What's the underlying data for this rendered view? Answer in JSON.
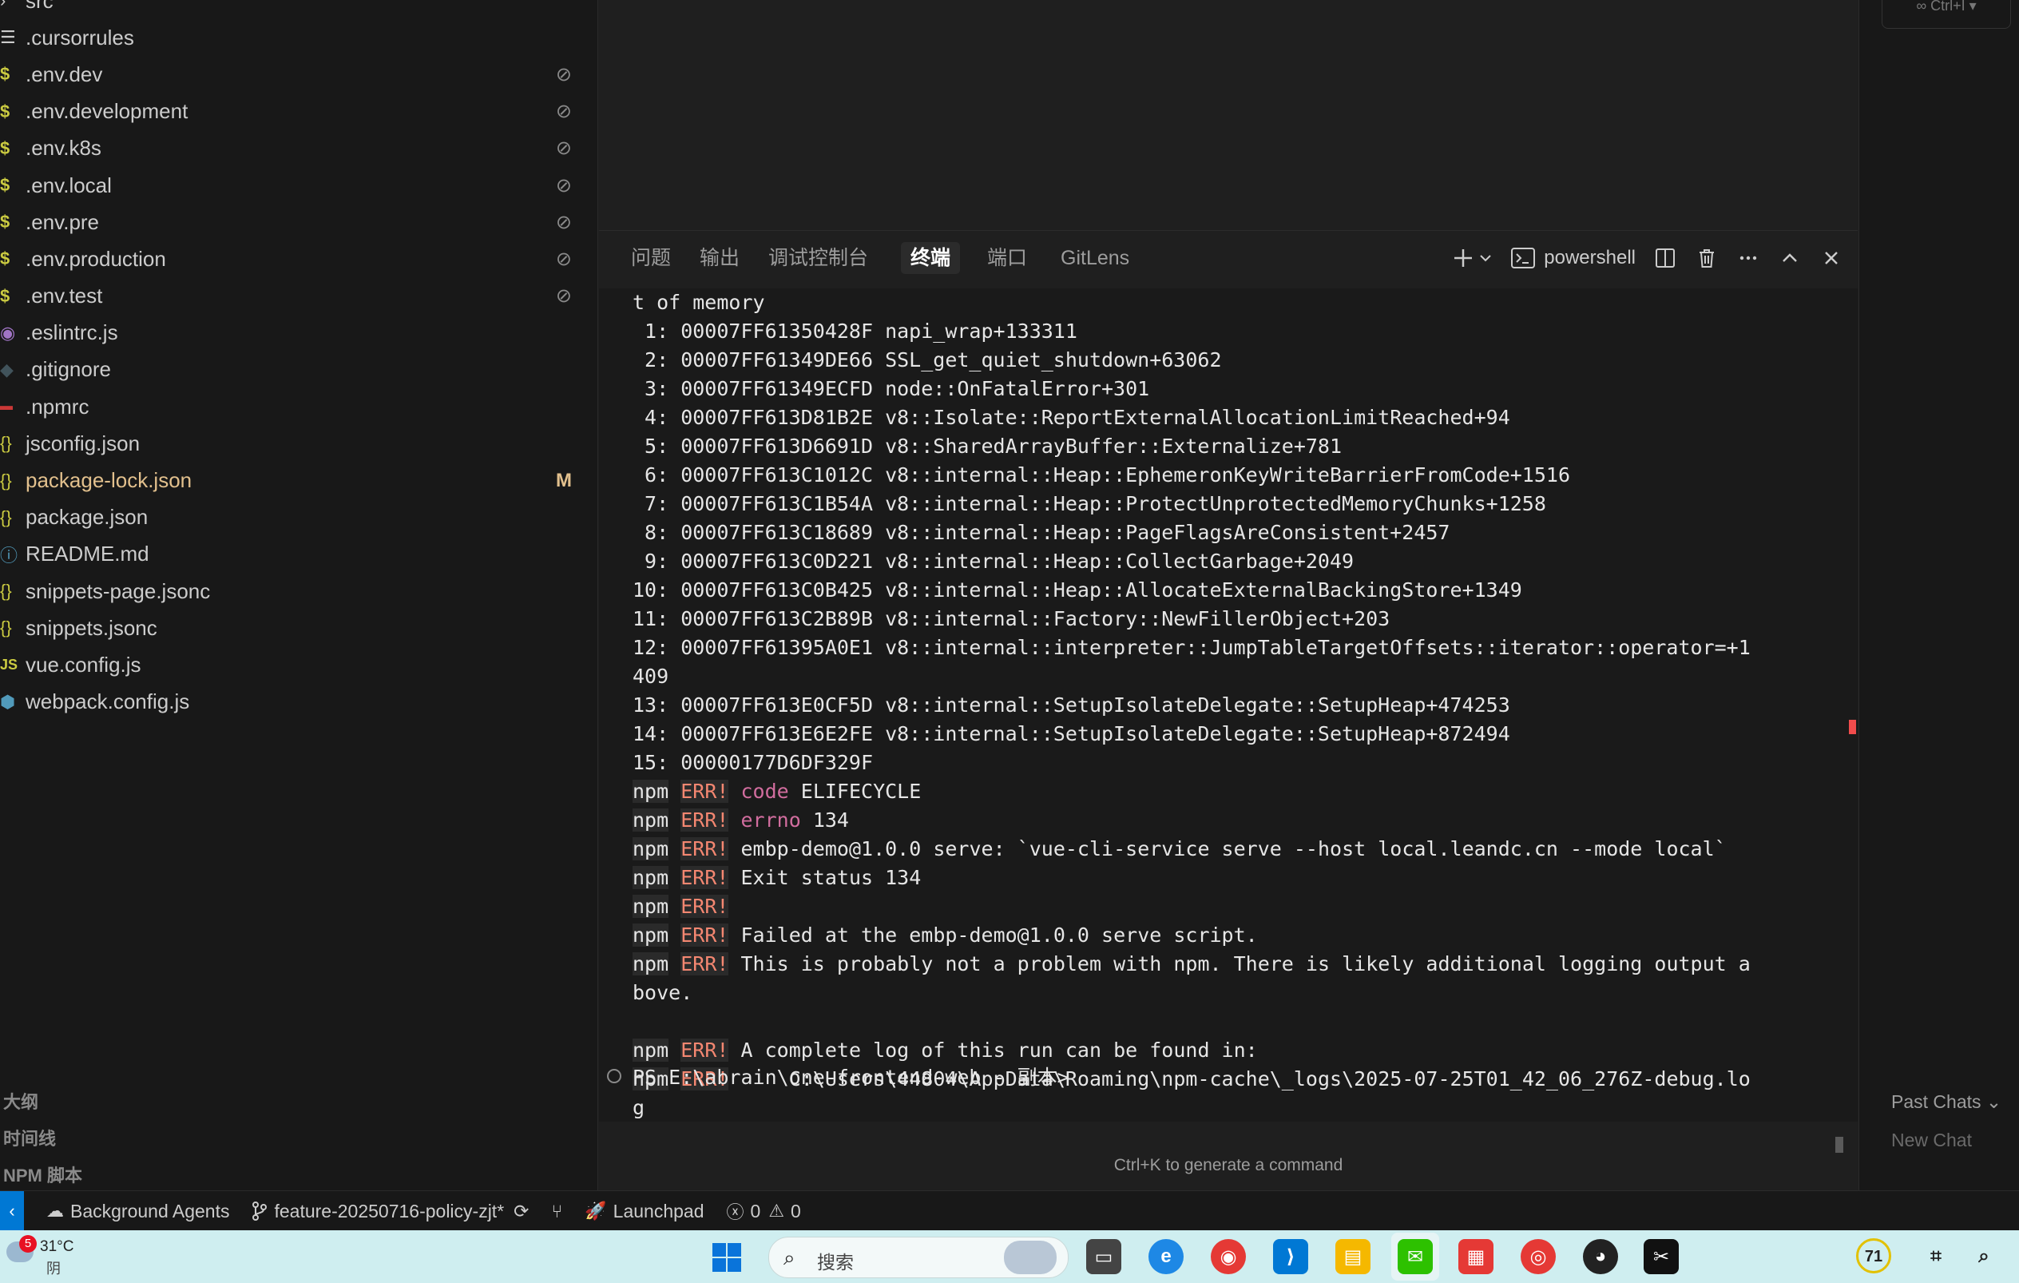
{
  "sidebar": {
    "files": [
      {
        "name": "src",
        "icon": "chevron-right-icon",
        "badge": ""
      },
      {
        "name": ".cursorrules",
        "icon": "lines-icon",
        "badge": ""
      },
      {
        "name": ".env.dev",
        "icon": "dollar-icon",
        "badge": "⊘"
      },
      {
        "name": ".env.development",
        "icon": "dollar-icon",
        "badge": "⊘"
      },
      {
        "name": ".env.k8s",
        "icon": "dollar-icon",
        "badge": "⊘"
      },
      {
        "name": ".env.local",
        "icon": "dollar-icon",
        "badge": "⊘"
      },
      {
        "name": ".env.pre",
        "icon": "dollar-icon",
        "badge": "⊘"
      },
      {
        "name": ".env.production",
        "icon": "dollar-icon",
        "badge": "⊘"
      },
      {
        "name": ".env.test",
        "icon": "dollar-icon",
        "badge": "⊘"
      },
      {
        "name": ".eslintrc.js",
        "icon": "eslint-icon",
        "badge": ""
      },
      {
        "name": ".gitignore",
        "icon": "git-icon",
        "badge": ""
      },
      {
        "name": ".npmrc",
        "icon": "npm-icon",
        "badge": ""
      },
      {
        "name": "jsconfig.json",
        "icon": "json-icon",
        "badge": ""
      },
      {
        "name": "package-lock.json",
        "icon": "json-icon",
        "badge": "M"
      },
      {
        "name": "package.json",
        "icon": "json-icon",
        "badge": ""
      },
      {
        "name": "README.md",
        "icon": "info-icon",
        "badge": ""
      },
      {
        "name": "snippets-page.jsonc",
        "icon": "json-icon",
        "badge": ""
      },
      {
        "name": "snippets.jsonc",
        "icon": "json-icon",
        "badge": ""
      },
      {
        "name": "vue.config.js",
        "icon": "js-icon",
        "badge": ""
      },
      {
        "name": "webpack.config.js",
        "icon": "webpack-icon",
        "badge": ""
      }
    ],
    "sections": [
      "大纲",
      "时间线",
      "NPM 脚本"
    ]
  },
  "panel": {
    "tabs": [
      {
        "label": "问题",
        "active": false
      },
      {
        "label": "输出",
        "active": false
      },
      {
        "label": "调试控制台",
        "active": false
      },
      {
        "label": "终端",
        "active": true
      },
      {
        "label": "端口",
        "active": false
      },
      {
        "label": "GitLens",
        "active": false
      }
    ],
    "shell_name": "powershell",
    "terminal_lines": [
      {
        "text": "t of memory"
      },
      {
        "text": " 1: 00007FF61350428F napi_wrap+133311"
      },
      {
        "text": " 2: 00007FF61349DE66 SSL_get_quiet_shutdown+63062"
      },
      {
        "text": " 3: 00007FF61349ECFD node::OnFatalError+301"
      },
      {
        "text": " 4: 00007FF613D81B2E v8::Isolate::ReportExternalAllocationLimitReached+94"
      },
      {
        "text": " 5: 00007FF613D6691D v8::SharedArrayBuffer::Externalize+781"
      },
      {
        "text": " 6: 00007FF613C1012C v8::internal::Heap::EphemeronKeyWriteBarrierFromCode+1516"
      },
      {
        "text": " 7: 00007FF613C1B54A v8::internal::Heap::ProtectUnprotectedMemoryChunks+1258"
      },
      {
        "text": " 8: 00007FF613C18689 v8::internal::Heap::PageFlagsAreConsistent+2457"
      },
      {
        "text": " 9: 00007FF613C0D221 v8::internal::Heap::CollectGarbage+2049"
      },
      {
        "text": "10: 00007FF613C0B425 v8::internal::Heap::AllocateExternalBackingStore+1349"
      },
      {
        "text": "11: 00007FF613C2B89B v8::internal::Factory::NewFillerObject+203"
      },
      {
        "text": "12: 00007FF61395A0E1 v8::internal::interpreter::JumpTableTargetOffsets::iterator::operator=+1"
      },
      {
        "text": "409"
      },
      {
        "text": "13: 00007FF613E0CF5D v8::internal::SetupIsolateDelegate::SetupHeap+474253"
      },
      {
        "text": "14: 00007FF613E6E2FE v8::internal::SetupIsolateDelegate::SetupHeap+872494"
      },
      {
        "text": "15: 00000177D6DF329F"
      },
      {
        "npm": "npm",
        "err": "ERR!",
        "key": "code",
        "text": " ELIFECYCLE"
      },
      {
        "npm": "npm",
        "err": "ERR!",
        "key": "errno",
        "text": " 134"
      },
      {
        "npm": "npm",
        "err": "ERR!",
        "text": "embp-demo@1.0.0 serve: `vue-cli-service serve --host local.leandc.cn --mode local`"
      },
      {
        "npm": "npm",
        "err": "ERR!",
        "text": "Exit status 134"
      },
      {
        "npm": "npm",
        "err": "ERR!",
        "text": ""
      },
      {
        "npm": "npm",
        "err": "ERR!",
        "text": "Failed at the embp-demo@1.0.0 serve script."
      },
      {
        "npm": "npm",
        "err": "ERR!",
        "text": "This is probably not a problem with npm. There is likely additional logging output a"
      },
      {
        "text": "bove."
      },
      {
        "text": ""
      },
      {
        "npm": "npm",
        "err": "ERR!",
        "text": "A complete log of this run can be found in:"
      },
      {
        "npm": "npm",
        "err": "ERR!",
        "text": "    C:\\Users\\44804\\AppData\\Roaming\\npm-cache\\_logs\\2025-07-25T01_42_06_276Z-debug.lo"
      },
      {
        "text": "g"
      }
    ],
    "prompt": "PS E:\\abrain\\one-frontend-web - 副本>",
    "hint": "Ctrl+K to generate a command"
  },
  "right_panel": {
    "top_button": "∞ Ctrl+I ▾",
    "past_chats": "Past Chats ⌄",
    "new_chat": "New Chat"
  },
  "statusbar": {
    "background_agents": "Background Agents",
    "branch": "feature-20250716-policy-zjt*",
    "launchpad": "Launchpad",
    "errors": "0",
    "warnings": "0"
  },
  "taskbar": {
    "weather_badge": "5",
    "temperature": "31°C",
    "condition": "阴",
    "search_placeholder": "搜索",
    "tray_badge": "71"
  }
}
